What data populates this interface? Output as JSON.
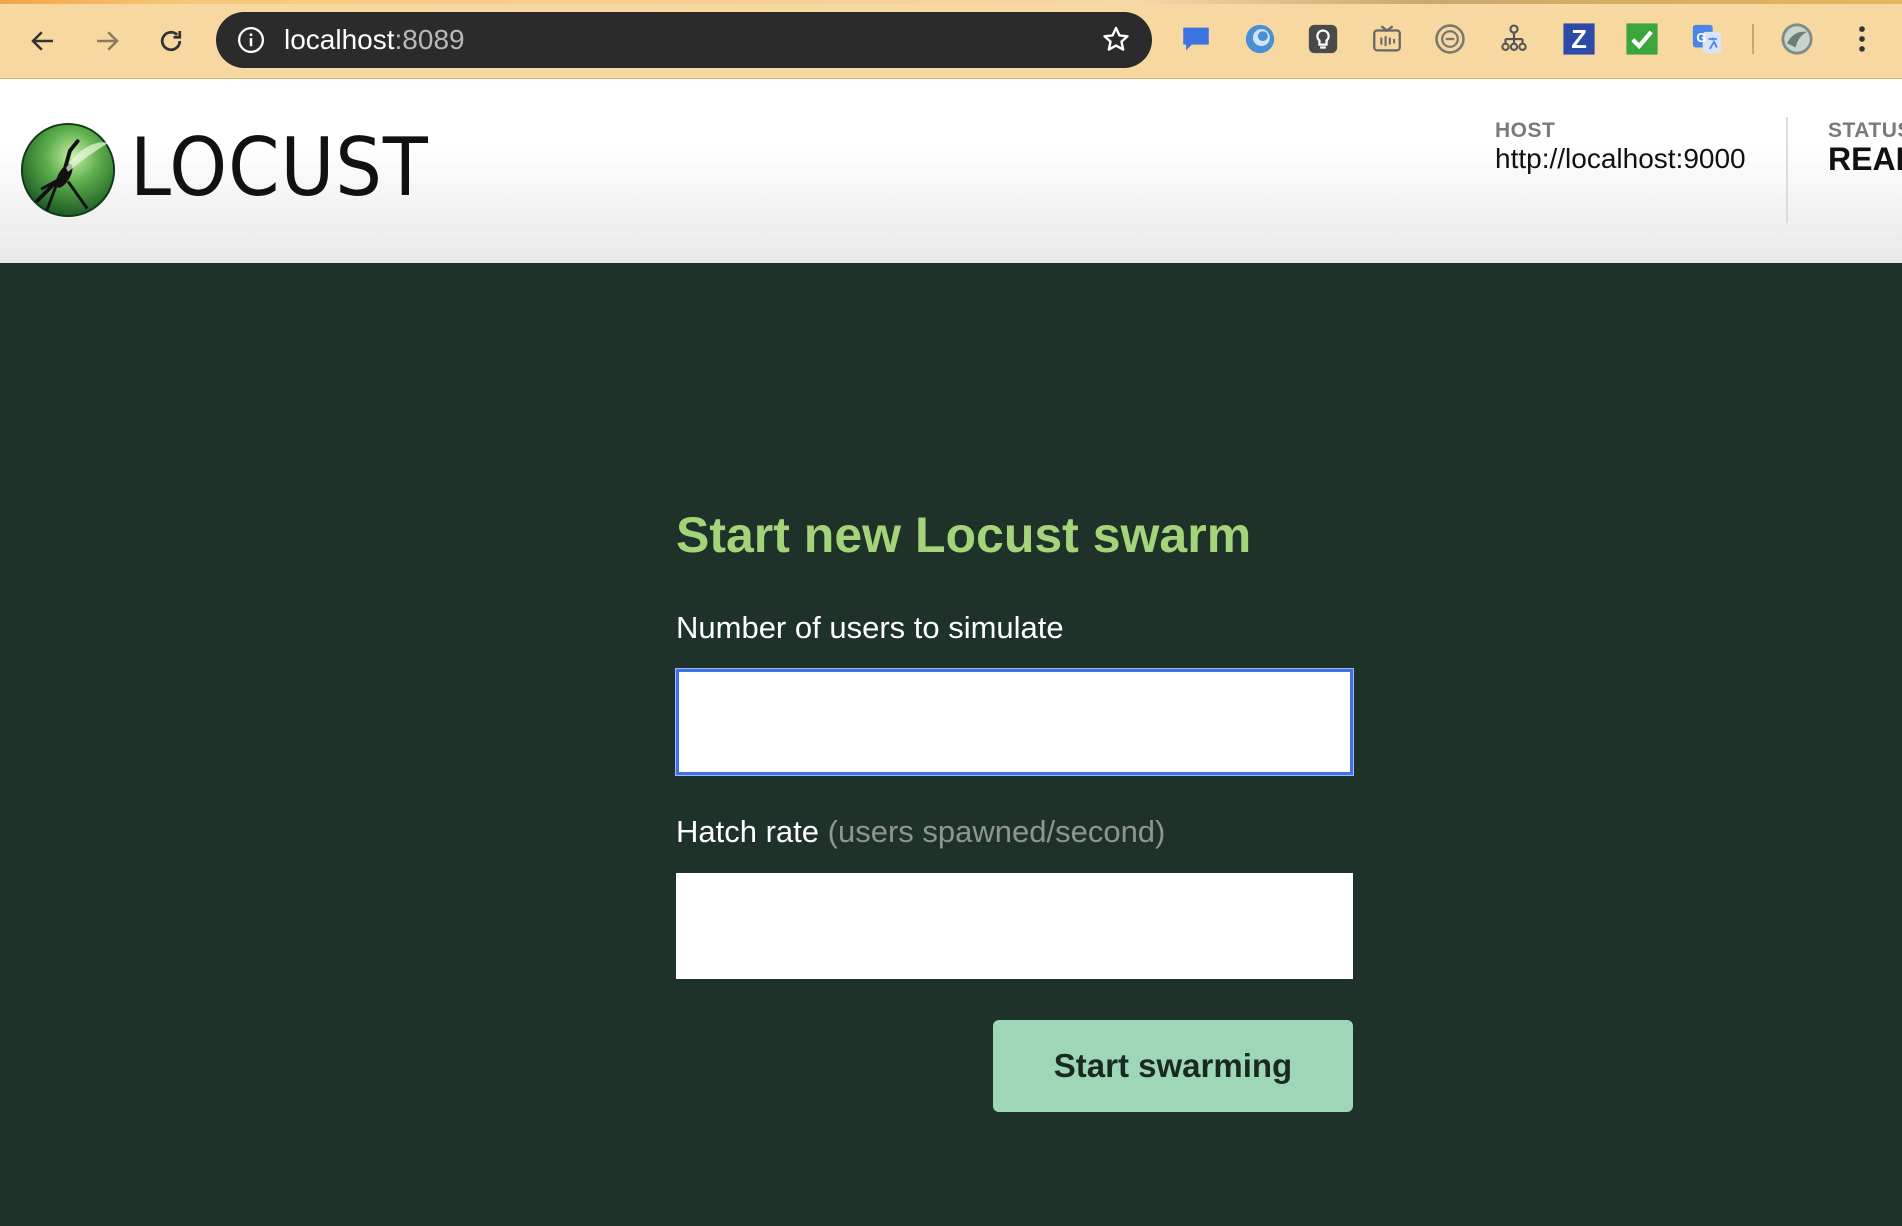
{
  "browser": {
    "url_host": "localhost",
    "url_port": ":8089",
    "icons": [
      "back-icon",
      "forward-icon",
      "reload-icon",
      "info-icon",
      "bookmark-star-icon",
      "menu-dots-icon"
    ],
    "extensions": [
      "chat-extension-icon",
      "blue-circle-extension-icon",
      "lightbulb-extension-icon",
      "media-extension-icon",
      "ring-extension-icon",
      "sitemap-extension-icon",
      "z-extension-icon",
      "checkmark-extension-icon",
      "google-translate-icon",
      "profile-avatar-icon"
    ],
    "z_label": "Z"
  },
  "header": {
    "logo_text": "LOCUST",
    "host_label": "HOST",
    "host_value": "http://localhost:9000",
    "status_label": "STATUS",
    "status_value": "READY"
  },
  "form": {
    "title": "Start new Locust swarm",
    "users_label": "Number of users to simulate",
    "users_value": "",
    "hatch_label": "Hatch rate",
    "hatch_hint": "(users spawned/second)",
    "hatch_value": "",
    "submit_label": "Start swarming"
  },
  "colors": {
    "page_bg": "#1f322a",
    "title_green": "#a5d37a",
    "button_bg": "#9dd7b8",
    "chrome_bg": "#f7d8a0"
  }
}
